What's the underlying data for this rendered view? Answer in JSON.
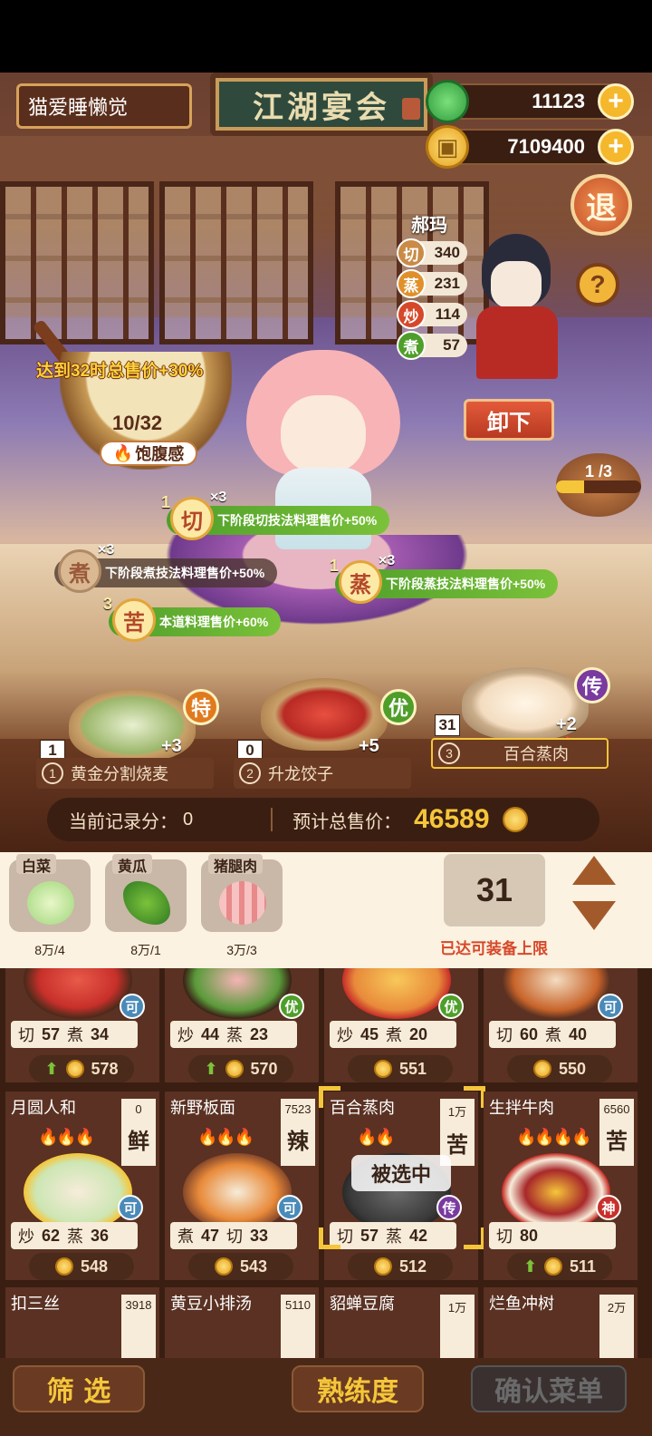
{
  "header": {
    "player_name": "猫爱睡懒觉",
    "sign_title": "江湖宴会",
    "jade_amount": "11123",
    "coin_amount": "7109400",
    "plus": "+",
    "exit_label": "退",
    "help_label": "?"
  },
  "npc": {
    "name": "郝玛",
    "stats": [
      {
        "skill": "切",
        "value": "340",
        "color": "#c98b46"
      },
      {
        "skill": "蒸",
        "value": "231",
        "color": "#e0902a"
      },
      {
        "skill": "炒",
        "value": "114",
        "color": "#d6482a"
      },
      {
        "skill": "煮",
        "value": "57",
        "color": "#4f9e2a"
      }
    ],
    "unload_label": "卸下",
    "progress_text": "1 /3",
    "progress_fraction": 0.33
  },
  "bowl": {
    "bonus_text": "达到32时总售价+30%",
    "count": "10/32",
    "satiety_label": "饱腹感"
  },
  "skills": [
    {
      "level": "1",
      "badge": "切",
      "mult": "×3",
      "text": "下阶段切技法料理售价+50%",
      "style": "green"
    },
    {
      "level": "",
      "badge": "煮",
      "mult": "×3",
      "text": "下阶段煮技法料理售价+50%",
      "style": "gray"
    },
    {
      "level": "1",
      "badge": "蒸",
      "mult": "×3",
      "text": "下阶段蒸技法料理售价+50%",
      "style": "green"
    },
    {
      "level": "3",
      "badge": "苦",
      "mult": "",
      "text": "本道料理售价+60%",
      "style": "green"
    }
  ],
  "course": [
    {
      "index": "1",
      "name": "黄金分割烧麦",
      "count": "1",
      "bonus": "+3",
      "rank": "特",
      "rank_color": "#e07a1e"
    },
    {
      "index": "2",
      "name": "升龙饺子",
      "count": "0",
      "bonus": "+5",
      "rank": "优",
      "rank_color": "#4f9e2a"
    },
    {
      "index": "3",
      "name": "百合蒸肉",
      "count": "31",
      "bonus": "+2",
      "rank": "传",
      "rank_color": "#7a3aa0"
    }
  ],
  "score": {
    "record_label": "当前记录分：",
    "record_value": "0",
    "total_label": "预计总售价：",
    "total_value": "46589"
  },
  "ingredients": [
    {
      "name": "白菜",
      "count": "8万/4",
      "color": "#9fd67a"
    },
    {
      "name": "黄瓜",
      "count": "8万/1",
      "color": "#3f9a2e"
    },
    {
      "name": "猪腿肉",
      "count": "3万/3",
      "color": "#f0a6a6"
    }
  ],
  "equip": {
    "count": "31",
    "message": "已达可装备上限"
  },
  "dishes_row1": [
    {
      "rq": "可",
      "rq_color": "#4a8ab8",
      "s1": "切",
      "v1": "57",
      "s2": "煮",
      "v2": "34",
      "price": "578",
      "up": true
    },
    {
      "rq": "优",
      "rq_color": "#4f9e2a",
      "s1": "炒",
      "v1": "44",
      "s2": "蒸",
      "v2": "23",
      "price": "570",
      "up": true
    },
    {
      "rq": "优",
      "rq_color": "#4f9e2a",
      "s1": "炒",
      "v1": "45",
      "s2": "煮",
      "v2": "20",
      "price": "551",
      "up": false
    },
    {
      "rq": "可",
      "rq_color": "#4a8ab8",
      "s1": "切",
      "v1": "60",
      "s2": "煮",
      "v2": "40",
      "price": "550",
      "up": false
    }
  ],
  "dishes_row2": [
    {
      "name": "月圆人和",
      "qty": "0",
      "taste": "鲜",
      "rq": "可",
      "rq_color": "#4a8ab8",
      "flames": "🔥🔥🔥",
      "s1": "炒",
      "v1": "62",
      "s2": "蒸",
      "v2": "36",
      "price": "548",
      "up": false
    },
    {
      "name": "新野板面",
      "qty": "7523",
      "taste": "辣",
      "rq": "可",
      "rq_color": "#4a8ab8",
      "flames": "🔥🔥🔥",
      "s1": "煮",
      "v1": "47",
      "s2": "切",
      "v2": "33",
      "price": "543",
      "up": false
    },
    {
      "name": "百合蒸肉",
      "qty": "1万",
      "taste": "苦",
      "rq": "传",
      "rq_color": "#7a3aa0",
      "flames": "🔥🔥",
      "s1": "切",
      "v1": "57",
      "s2": "蒸",
      "v2": "42",
      "price": "512",
      "up": false,
      "selected": "被选中"
    },
    {
      "name": "生拌牛肉",
      "qty": "6560",
      "taste": "苦",
      "rq": "神",
      "rq_color": "#c8302a",
      "flames": "🔥🔥🔥🔥",
      "s1": "切",
      "v1": "80",
      "s2": "",
      "v2": "",
      "price": "511",
      "up": true
    }
  ],
  "dishes_row3": [
    {
      "name": "扣三丝",
      "qty": "3918"
    },
    {
      "name": "黄豆小排汤",
      "qty": "5110"
    },
    {
      "name": "貂蝉豆腐",
      "qty": "1万"
    },
    {
      "name": "烂鱼冲树",
      "qty": "2万"
    }
  ],
  "footer": {
    "filter_label": "筛 选",
    "proficiency_label": "熟练度",
    "confirm_label": "确认菜单"
  }
}
